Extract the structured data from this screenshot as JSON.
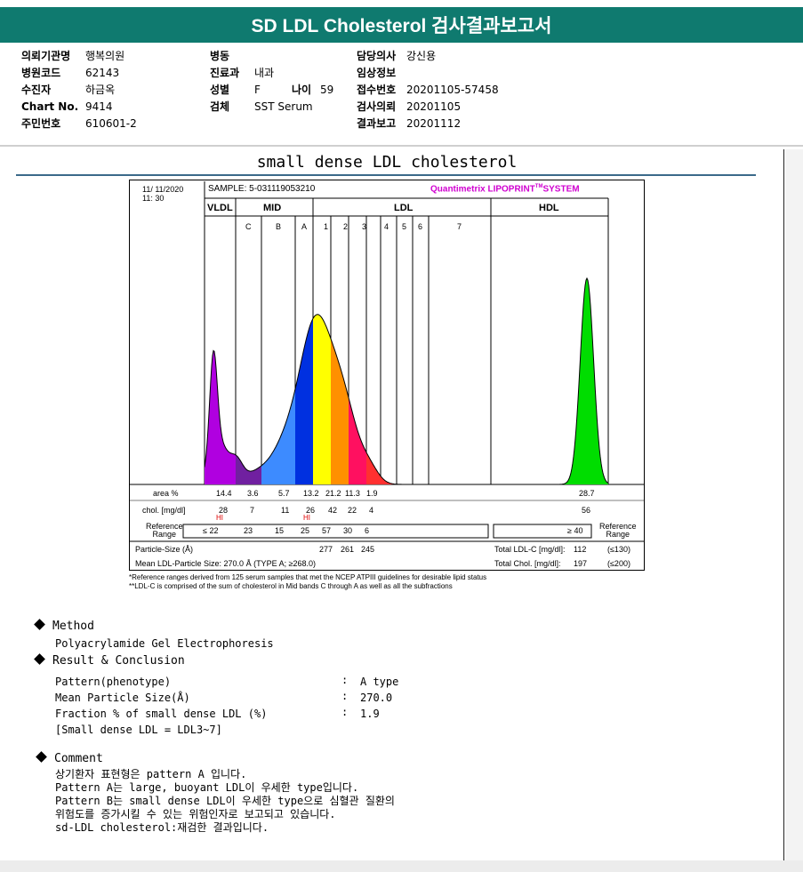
{
  "title": "SD LDL Cholesterol 검사결과보고서",
  "info": {
    "col1": [
      {
        "label": "의뢰기관명",
        "value": "행복의원"
      },
      {
        "label": "병원코드",
        "value": "62143"
      },
      {
        "label": "수진자",
        "value": "하금옥"
      },
      {
        "label": "Chart No.",
        "value": "9414"
      },
      {
        "label": "주민번호",
        "value": "610601-2"
      }
    ],
    "col2": {
      "ward_label": "병동",
      "ward_value": "",
      "dept_label": "진료과",
      "dept_value": "내과",
      "sex_label": "성별",
      "sex_value": "F",
      "age_label": "나이",
      "age_value": "59",
      "specimen_label": "검체",
      "specimen_value": "SST Serum"
    },
    "col3": [
      {
        "label": "담당의사",
        "value": "강신용"
      },
      {
        "label": "임상정보",
        "value": ""
      },
      {
        "label": "접수번호",
        "value": "20201105-57458"
      },
      {
        "label": "검사의뢰",
        "value": "20201105"
      },
      {
        "label": "결과보고",
        "value": "20201112"
      }
    ]
  },
  "chart_title": "small dense LDL cholesterol",
  "chart_header": {
    "date": "11/ 11/2020",
    "time": "11: 30",
    "sample": "SAMPLE:   5-031119053210",
    "brand": "Quantimetrix LIPOPRINT",
    "brand_tm": "TM",
    "brand_suffix": "SYSTEM",
    "groups": [
      "VLDL",
      "MID",
      "LDL",
      "HDL"
    ],
    "subbands": [
      "C",
      "B",
      "A",
      "1",
      "2",
      "3",
      "4",
      "5",
      "6",
      "7"
    ]
  },
  "chart_data": {
    "type": "area",
    "description_fields": "densitometric electrophoresis profile",
    "bands": [
      "VLDL",
      "C",
      "B",
      "A",
      "1",
      "2",
      "3",
      "4",
      "5",
      "6",
      "7",
      "HDL"
    ],
    "area_pct": [
      14.4,
      3.6,
      5.7,
      13.2,
      21.2,
      11.3,
      1.9,
      null,
      null,
      null,
      null,
      28.7
    ],
    "chol_mg_dl": [
      28,
      7,
      11,
      26,
      42,
      22,
      4,
      null,
      null,
      null,
      null,
      56
    ],
    "flags": {
      "VLDL": "HI",
      "A": "HI"
    },
    "reference_range": [
      "≤ 22",
      "23",
      "15",
      "25",
      "57",
      "30",
      "6",
      "≥ 40"
    ],
    "particle_size_A": {
      "1": 277,
      "2": 261,
      "3": 245
    },
    "colors": {
      "VLDL": "#b000e0",
      "C": "#7020a0",
      "B": "#3d8bff",
      "A": "#0030e0",
      "1": "#ffff00",
      "2": "#ff9000",
      "3": "#ff1060",
      "4": "#ff3030",
      "HDL": "#00dd00"
    },
    "peaks": {
      "VLDL": 0.48,
      "A": 0.76,
      "HDL": 1.0
    }
  },
  "table": {
    "row_area": "area %",
    "row_chol": "chol. [mg/dl]",
    "row_ref1": "Reference",
    "row_ref2": "Range",
    "ref_right1": "Reference",
    "ref_right2": "Range",
    "hi": "HI",
    "particle_label": "Particle-Size (Å)",
    "mean_label": "Mean LDL-Particle Size:   270.0 Å   (TYPE A; ≥268.0)",
    "total_ldl_label": "Total LDL-C [mg/dl]:",
    "total_ldl_value": "112",
    "total_ldl_ref": "(≤130)",
    "total_chol_label": "Total Chol. [mg/dl]:",
    "total_chol_value": "197",
    "total_chol_ref": "(≤200)",
    "footnote1": "*Reference ranges derived from 125 serum samples that met the NCEP ATPIII guidelines for desirable lipid status",
    "footnote2": "**LDL-C is comprised of the sum of cholesterol in Mid bands C through A as well as all the subfractions"
  },
  "method": {
    "heading": "Method",
    "text": "Polyacrylamide Gel Electrophoresis"
  },
  "result": {
    "heading": "Result & Conclusion",
    "rows": [
      {
        "label": "Pattern(phenotype)",
        "sep": ":",
        "value": "A type"
      },
      {
        "label": "Mean Particle Size(Å)",
        "sep": ":",
        "value": "270.0"
      },
      {
        "label": "Fraction % of small dense LDL (%)",
        "sep": ":",
        "value": "1.9"
      }
    ],
    "note": "[Small dense LDL = LDL3~7]"
  },
  "comment": {
    "heading": "Comment",
    "lines": [
      "상기환자 표현형은 pattern A 입니다.",
      "Pattern A는 large, buoyant LDL이 우세한 type입니다.",
      "Pattern B는 small dense LDL이 우세한 type으로 심혈관 질환의",
      "위험도를 증가시킬 수 있는 위험인자로 보고되고 있습니다.",
      "sd-LDL cholesterol:재검한 결과입니다."
    ]
  }
}
